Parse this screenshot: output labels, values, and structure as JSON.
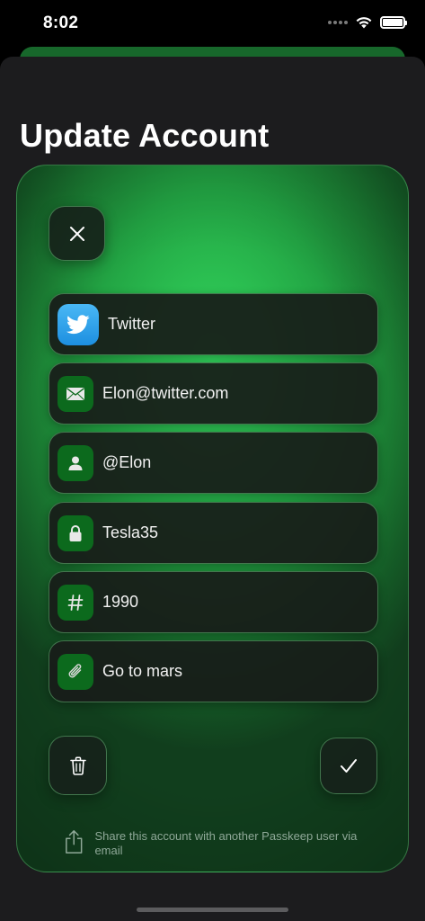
{
  "status": {
    "time": "8:02"
  },
  "header": {
    "title": "Update Account"
  },
  "fields": [
    {
      "icon": "twitter-logo-icon",
      "value": "Twitter"
    },
    {
      "icon": "envelope-icon",
      "value": "Elon@twitter.com"
    },
    {
      "icon": "person-icon",
      "value": "@Elon"
    },
    {
      "icon": "lock-icon",
      "value": "Tesla35"
    },
    {
      "icon": "hashtag-icon",
      "value": "1990"
    },
    {
      "icon": "paperclip-icon",
      "value": "Go to mars"
    }
  ],
  "share": {
    "text": "Share this account with another Passkeep user via email"
  },
  "colors": {
    "accent": "#31d15b",
    "icon_bg": "#0c6a1d",
    "sheet_bg": "#1c1c1e"
  }
}
